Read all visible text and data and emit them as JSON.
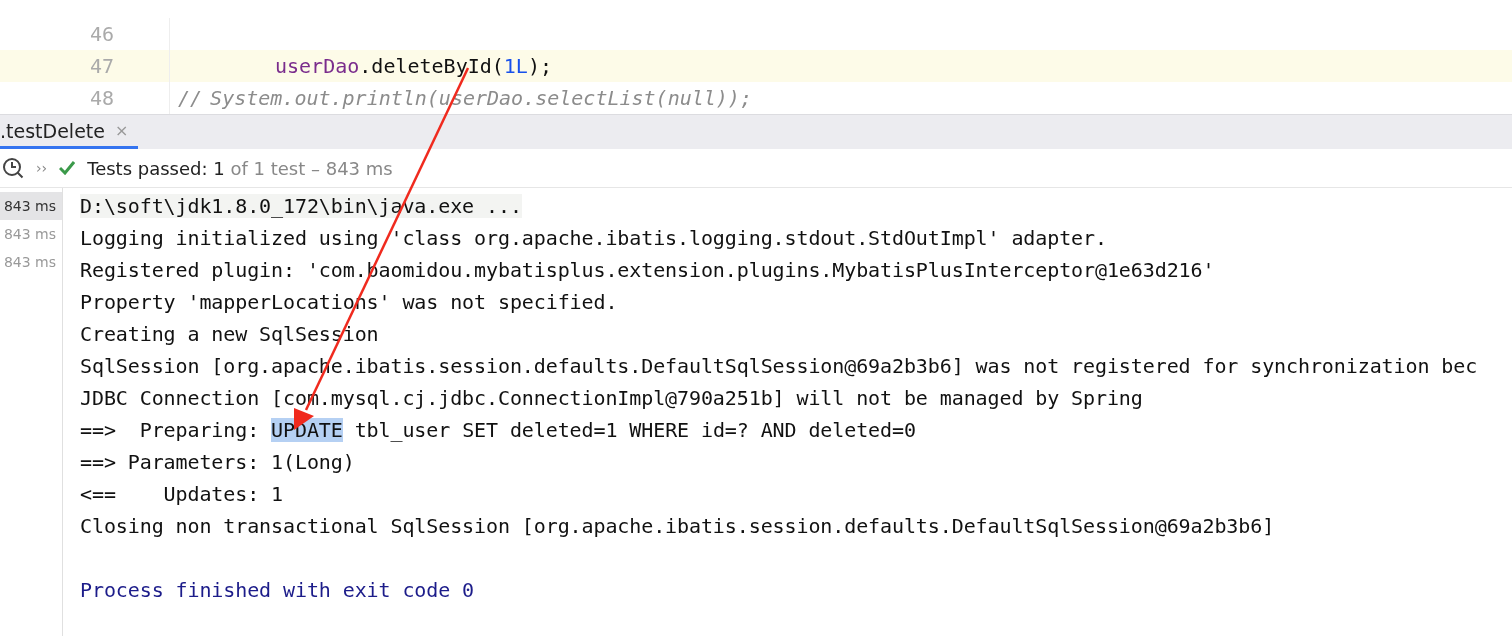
{
  "editor": {
    "lines": [
      {
        "number": "46",
        "kind": "code"
      },
      {
        "number": "47",
        "kind": "current",
        "segments": [
          {
            "text": "userDao",
            "kind": "field"
          },
          {
            "text": ".deleteById(",
            "kind": "plain"
          },
          {
            "text": "1L",
            "kind": "number"
          },
          {
            "text": ");",
            "kind": "plain"
          }
        ]
      },
      {
        "number": "48",
        "kind": "comment",
        "segments": [
          {
            "text": "//",
            "kind": "comment"
          },
          {
            "text": "System.out.println(userDao.selectList(null));",
            "kind": "comment"
          }
        ]
      }
    ]
  },
  "tab": {
    "label": ".testDelete",
    "close": "×",
    "selected": true
  },
  "toolbar": {
    "more": "››",
    "status": "Tests passed:",
    "count": "1",
    "detail": "of 1 test – 843 ms"
  },
  "test_tree": [
    {
      "label": "843 ms",
      "selected": true
    },
    {
      "label": "843 ms",
      "selected": false
    },
    {
      "label": "843 ms",
      "selected": false
    }
  ],
  "console": [
    {
      "kind": "command",
      "text": "D:\\soft\\jdk1.8.0_172\\bin\\java.exe ..."
    },
    {
      "kind": "plain",
      "text": "Logging initialized using 'class org.apache.ibatis.logging.stdout.StdOutImpl' adapter."
    },
    {
      "kind": "plain",
      "text": "Registered plugin: 'com.baomidou.mybatisplus.extension.plugins.MybatisPlusInterceptor@1e63d216'"
    },
    {
      "kind": "plain",
      "text": "Property 'mapperLocations' was not specified."
    },
    {
      "kind": "plain",
      "text": "Creating a new SqlSession"
    },
    {
      "kind": "plain",
      "text": "SqlSession [org.apache.ibatis.session.defaults.DefaultSqlSession@69a2b3b6] was not registered for synchronization bec"
    },
    {
      "kind": "plain",
      "text": "JDBC Connection [com.mysql.cj.jdbc.ConnectionImpl@790a251b] will not be managed by Spring"
    },
    {
      "kind": "plain",
      "segments": [
        {
          "text": "==>  Preparing: ",
          "selected": false
        },
        {
          "text": "UPDATE",
          "selected": true
        },
        {
          "text": " tbl_user SET deleted=1 WHERE id=? AND deleted=0",
          "selected": false
        }
      ]
    },
    {
      "kind": "plain",
      "text": "==> Parameters: 1(Long)"
    },
    {
      "kind": "plain",
      "text": "<==    Updates: 1"
    },
    {
      "kind": "plain",
      "text": "Closing non transactional SqlSession [org.apache.ibatis.session.defaults.DefaultSqlSession@69a2b3b6]"
    },
    {
      "kind": "blank"
    },
    {
      "kind": "exit",
      "text": "Process finished with exit code 0"
    }
  ]
}
